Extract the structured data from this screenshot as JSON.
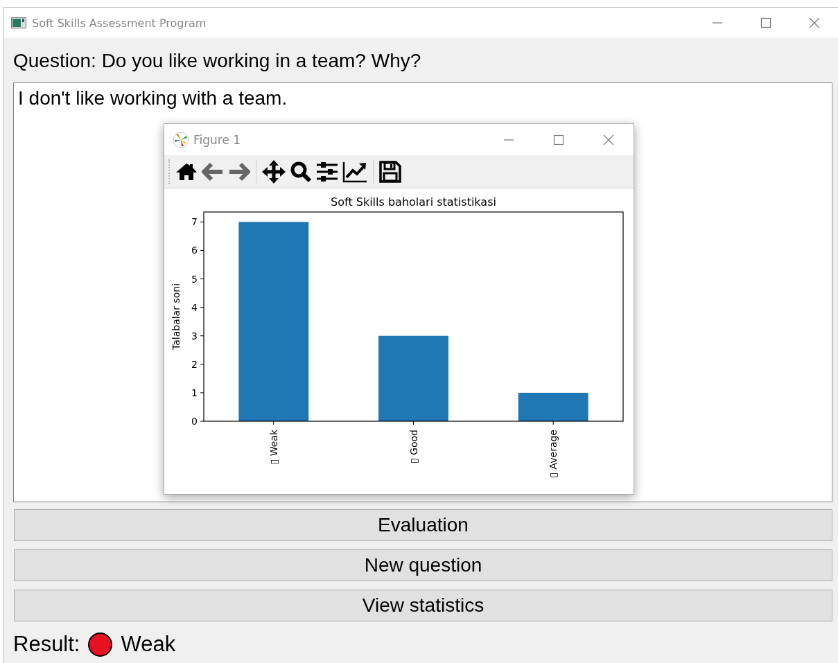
{
  "window": {
    "title": "Soft Skills Assessment Program"
  },
  "question": {
    "label": "Question: Do you like working in a team? Why?"
  },
  "answer": {
    "value": "I don't like working with a team."
  },
  "figure": {
    "title": "Figure 1",
    "chart_data": {
      "type": "bar",
      "title": "Soft Skills baholari statistikasi",
      "ylabel": "Talabalar soni",
      "categories": [
        "▯ Weak",
        "▯ Good",
        "▯ Average"
      ],
      "series": [
        {
          "color": "#1f77b4",
          "values": [
            7,
            3,
            1
          ]
        }
      ],
      "ylim": [
        0,
        7.35
      ],
      "yticks": [
        0,
        1,
        2,
        3,
        4,
        5,
        6,
        7
      ]
    }
  },
  "buttons": [
    "Evaluation",
    "New question",
    "View statistics"
  ],
  "result": {
    "label": "Result:",
    "color": "#e81123",
    "text": "Weak"
  }
}
